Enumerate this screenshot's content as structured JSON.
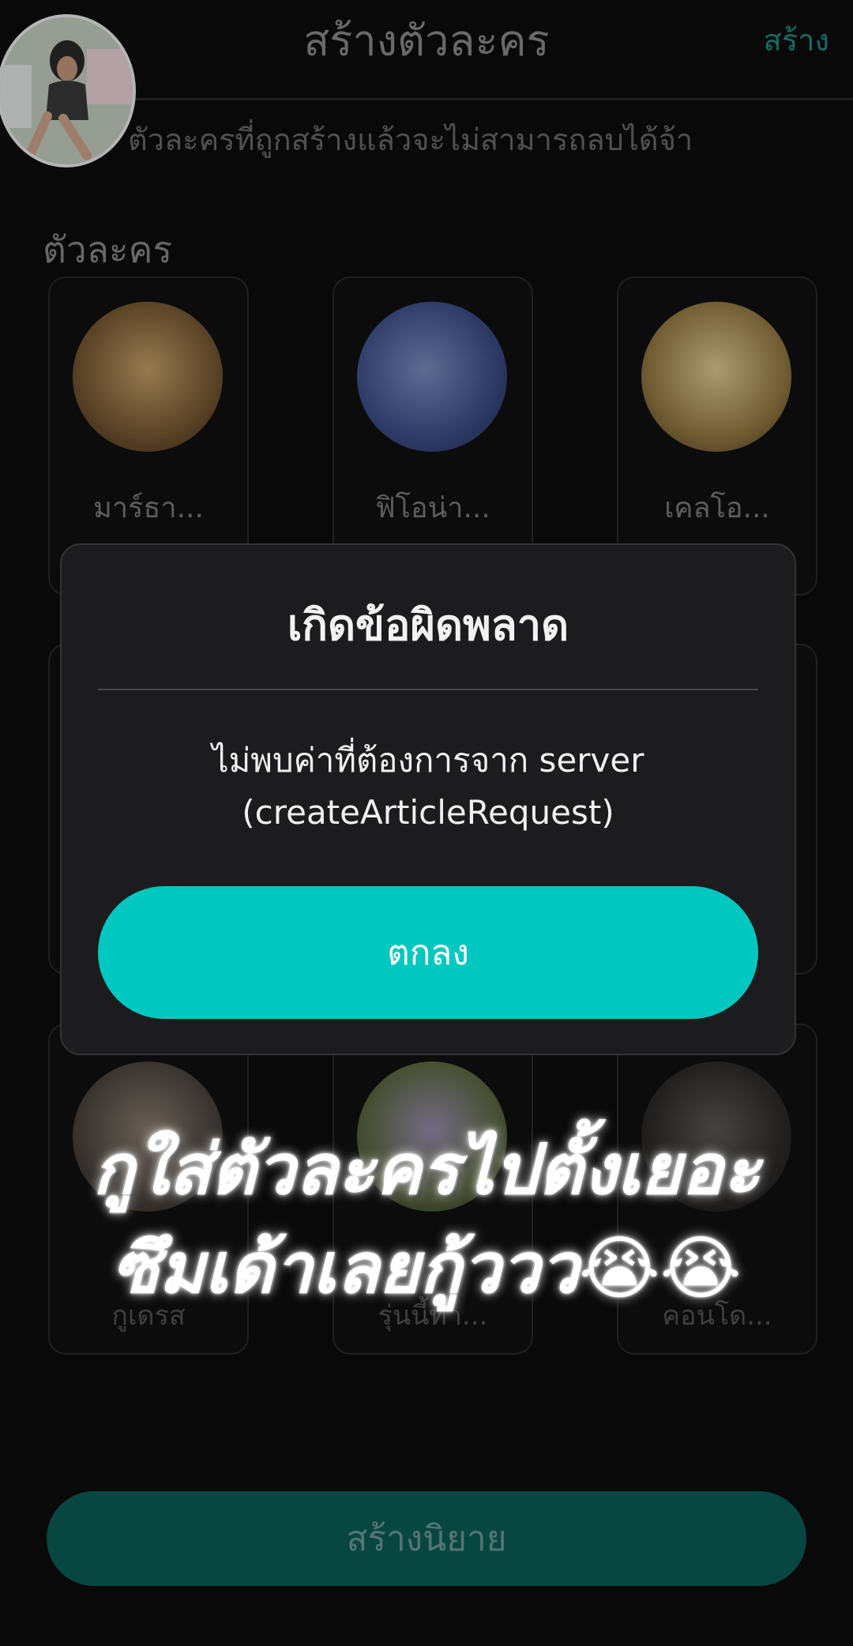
{
  "header": {
    "title": "สร้างตัวละคร",
    "action_label": "สร้าง"
  },
  "notice": "ตัวละครที่ถูกสร้างแล้วจะไม่สามารถลบได้จ้า",
  "section_label": "ตัวละคร",
  "characters_row1": [
    {
      "name": "มาร์ธา...",
      "sub": ""
    },
    {
      "name": "ฟิโอน่า...",
      "sub": ""
    },
    {
      "name": "เคลโอ...",
      "sub": ""
    }
  ],
  "characters_row3": [
    {
      "name": "",
      "sub": "กูเดรส"
    },
    {
      "name": "",
      "sub": "รุ่นนี้ทำ..."
    },
    {
      "name": "",
      "sub": "คอนโด..."
    }
  ],
  "create_button_label": "สร้างนิยาย",
  "dialog": {
    "title": "เกิดข้อผิดพลาด",
    "message_line1": "ไม่พบค่าที่ต้องการจาก server",
    "message_line2": "(createArticleRequest)",
    "ok_label": "ตกลง"
  },
  "caption": {
    "line1": "กูใส่ตัวละครไปตั้งเยอะ",
    "line2": "ซึมเด้าเลยกู้ววว😭😭"
  },
  "colors": {
    "accent": "#00c8c0",
    "dialog_bg": "#1c1c1e",
    "create_button_bg": "#0b5e59"
  }
}
